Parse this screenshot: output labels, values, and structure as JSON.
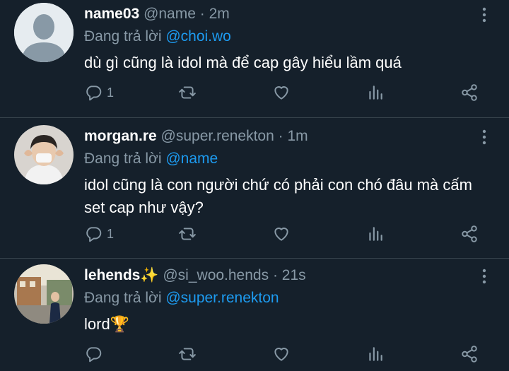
{
  "colors": {
    "background": "#15202b",
    "primary_text": "#ffffff",
    "secondary_text": "#8899a6",
    "mention": "#1d9bf0",
    "divider": "#38444d"
  },
  "tweets": [
    {
      "name": "name03",
      "handle": "@name",
      "time": "2m",
      "separator": "·",
      "replying_prefix": "Đang trả lời",
      "replying_to": "@choi.wo",
      "text": "dù gì cũng là idol mà để cap gây hiểu lầm quá",
      "reply_count": "1",
      "avatar": "default-avatar"
    },
    {
      "name": "morgan.re",
      "handle": "@super.renekton",
      "time": "1m",
      "separator": "·",
      "replying_prefix": "Đang trả lời",
      "replying_to": "@name",
      "text": "idol cũng là con người chứ có phải con chó đâu mà cấm set cap như vậy?",
      "reply_count": "1",
      "avatar": "person-heart-hands-photo"
    },
    {
      "name": "lehends✨",
      "handle": "@si_woo.hends",
      "time": "21s",
      "separator": "·",
      "replying_prefix": "Đang trả lời",
      "replying_to": "@super.renekton",
      "text": "lord🏆",
      "reply_count": "",
      "avatar": "street-photo"
    }
  ],
  "icons": [
    "reply-icon",
    "retweet-icon",
    "like-icon",
    "analytics-icon",
    "share-icon",
    "more-icon"
  ]
}
